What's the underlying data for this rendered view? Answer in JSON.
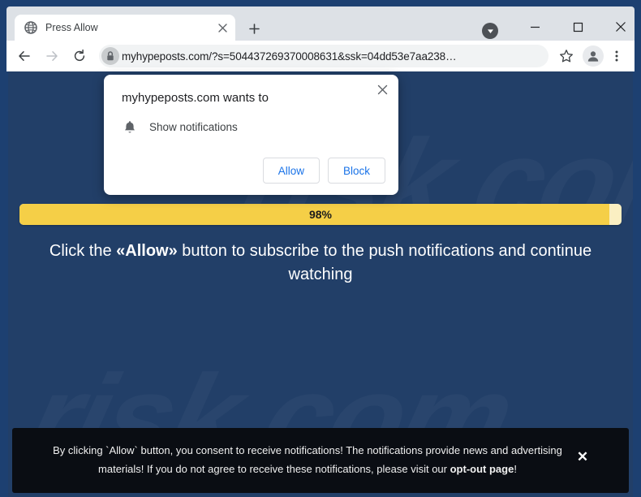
{
  "browser": {
    "tab": {
      "title": "Press Allow",
      "favicon": "globe-icon",
      "close_label": "×"
    },
    "new_tab_label": "+",
    "download_indicator": "download-arrow-icon",
    "window_controls": {
      "minimize": "−",
      "maximize": "□",
      "close": "×"
    },
    "toolbar": {
      "back": "back-arrow-icon",
      "forward": "forward-arrow-icon",
      "reload": "reload-icon",
      "lock": "lock-icon",
      "url": "myhypeposts.com/?s=504437269370008631&ssk=04dd53e7aa238…",
      "bookmark": "star-icon",
      "profile": "profile-avatar-icon",
      "menu": "three-dot-menu-icon"
    }
  },
  "permission_dialog": {
    "title": "myhypeposts.com wants to",
    "permission_icon": "bell-icon",
    "permission_label": "Show notifications",
    "allow_label": "Allow",
    "block_label": "Block",
    "close_label": "×"
  },
  "page": {
    "background_color": "#223f68",
    "watermark_text": "risk.com",
    "progress": {
      "percent": 98,
      "label": "98%",
      "fill_color": "#f5cf47",
      "track_color": "#faefc2"
    },
    "headline": {
      "before": "Click the ",
      "emphasis": "«Allow»",
      "after": " button to subscribe to the push notifications and continue watching"
    },
    "consent_banner": {
      "text_before": "By clicking `Allow` button, you consent to receive notifications! The notifications provide news and advertising materials! If you do not agree to receive these notifications, please visit our ",
      "link_text": "opt-out page",
      "text_after": "!",
      "close_label": "✕",
      "background_color": "#0a0d13"
    }
  }
}
